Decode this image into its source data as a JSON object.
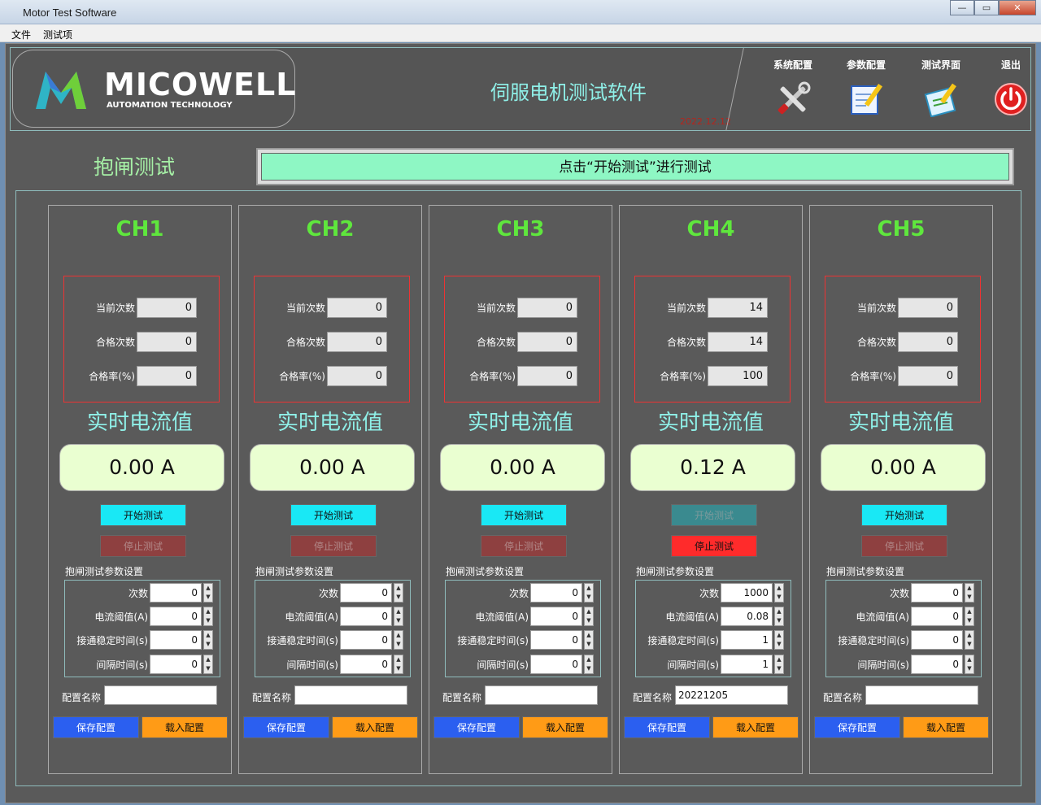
{
  "window": {
    "title": "Motor Test Software",
    "minimize": "—",
    "maximize": "▭",
    "close": "✕"
  },
  "menu": [
    "文件",
    "测试项"
  ],
  "header": {
    "logo": "MICOWELL",
    "logo_sub": "AUTOMATION TECHNOLOGY",
    "title": "伺服电机测试软件",
    "date": "2022.12.12",
    "nav": [
      "系统配置",
      "参数配置",
      "测试界面",
      "退出"
    ]
  },
  "section_title": "抱闸测试",
  "status_message": "点击“开始测试”进行测试",
  "labels": {
    "current_count": "当前次数",
    "pass_count": "合格次数",
    "pass_rate": "合格率(%)",
    "realtime_current": "实时电流值",
    "start": "开始测试",
    "stop": "停止测试",
    "param_settings": "抱闸测试参数设置",
    "times": "次数",
    "current_threshold": "电流阈值(A)",
    "settle_time": "接通稳定时间(s)",
    "interval": "间隔时间(s)",
    "config_name": "配置名称",
    "save": "保存配置",
    "load": "载入配置"
  },
  "colors": {
    "accent": "#8ff0e8",
    "channel": "#5fe73d",
    "status_bg": "#8ef7c4",
    "save": "#2b5ff0",
    "load": "#ff9b16"
  },
  "channels": [
    {
      "name": "CH1",
      "current_count": "0",
      "pass_count": "0",
      "pass_rate": "0",
      "current": "0.00 A",
      "running": false,
      "params": {
        "times": "0",
        "threshold": "0",
        "settle": "0",
        "interval": "0"
      },
      "config_name": ""
    },
    {
      "name": "CH2",
      "current_count": "0",
      "pass_count": "0",
      "pass_rate": "0",
      "current": "0.00 A",
      "running": false,
      "params": {
        "times": "0",
        "threshold": "0",
        "settle": "0",
        "interval": "0"
      },
      "config_name": ""
    },
    {
      "name": "CH3",
      "current_count": "0",
      "pass_count": "0",
      "pass_rate": "0",
      "current": "0.00 A",
      "running": false,
      "params": {
        "times": "0",
        "threshold": "0",
        "settle": "0",
        "interval": "0"
      },
      "config_name": ""
    },
    {
      "name": "CH4",
      "current_count": "14",
      "pass_count": "14",
      "pass_rate": "100",
      "current": "0.12 A",
      "running": true,
      "params": {
        "times": "1000",
        "threshold": "0.08",
        "settle": "1",
        "interval": "1"
      },
      "config_name": "20221205"
    },
    {
      "name": "CH5",
      "current_count": "0",
      "pass_count": "0",
      "pass_rate": "0",
      "current": "0.00 A",
      "running": false,
      "params": {
        "times": "0",
        "threshold": "0",
        "settle": "0",
        "interval": "0"
      },
      "config_name": ""
    }
  ]
}
